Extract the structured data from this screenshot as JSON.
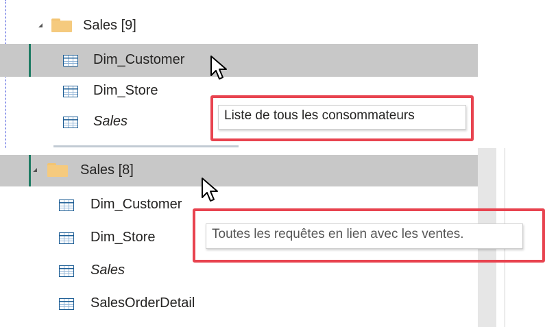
{
  "top": {
    "folder": {
      "label": "Sales [9]",
      "icon": "folder-icon"
    },
    "items": [
      {
        "label": "Dim_Customer",
        "icon": "table-icon",
        "italic": false,
        "selected": true
      },
      {
        "label": "Dim_Store",
        "icon": "table-icon",
        "italic": false
      },
      {
        "label": "Sales",
        "icon": "table-icon",
        "italic": true
      }
    ],
    "tooltip": "Liste de tous les consommateurs"
  },
  "bottom": {
    "folder": {
      "label": "Sales [8]",
      "icon": "folder-icon",
      "selected": true
    },
    "items": [
      {
        "label": "Dim_Customer",
        "icon": "table-icon",
        "italic": false
      },
      {
        "label": "Dim_Store",
        "icon": "table-icon",
        "italic": false
      },
      {
        "label": "Sales",
        "icon": "table-icon",
        "italic": true
      },
      {
        "label": "SalesOrderDetail",
        "icon": "table-icon",
        "italic": false
      }
    ],
    "tooltip": "Toutes les requêtes en lien avec les ventes."
  },
  "colors": {
    "highlight_box": "#e8434f",
    "selection_bar": "#1e7b63",
    "selected_row": "#c8c8c8"
  }
}
